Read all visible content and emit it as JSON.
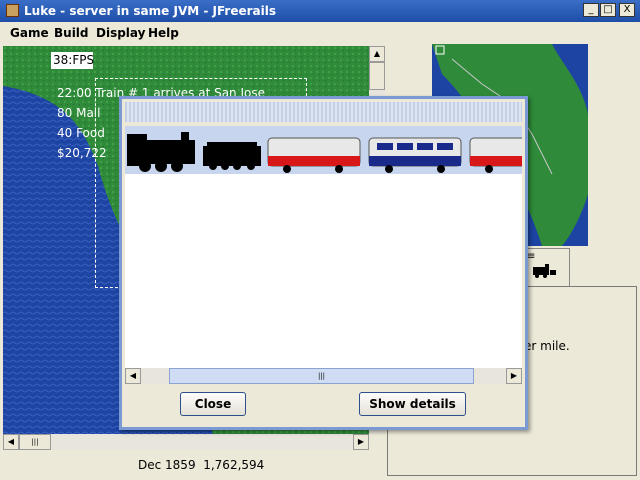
{
  "window": {
    "title": "Luke - server in same JVM - JFreerails",
    "minimize_glyph": "_",
    "maximize_glyph": "□",
    "close_glyph": "X"
  },
  "menubar": {
    "items": [
      "Game",
      "Build",
      "Display",
      "Help"
    ]
  },
  "map": {
    "fps": "38:FPS",
    "messages": [
      "22:00 Train # 1 arrives at San Jose",
      "80 Mail",
      "40 Food",
      "$20,722"
    ]
  },
  "status": {
    "date": "Dec 1859",
    "cash": "1,762,594"
  },
  "info_panel": {
    "text_fragment": "er mile."
  },
  "dialog": {
    "close_label": "Close",
    "details_label": "Show details"
  },
  "icons": {
    "scroll_up": "▲",
    "scroll_down": "▼",
    "scroll_left": "◀",
    "scroll_right": "▶",
    "thumb_grip": "|||"
  },
  "colors": {
    "title_bar": "#1e4ea8",
    "ocean": "#1d44a3",
    "land": "#2f8a3a",
    "dialog_border": "#7b9ad4",
    "train_strip": "#c7d6ee"
  }
}
